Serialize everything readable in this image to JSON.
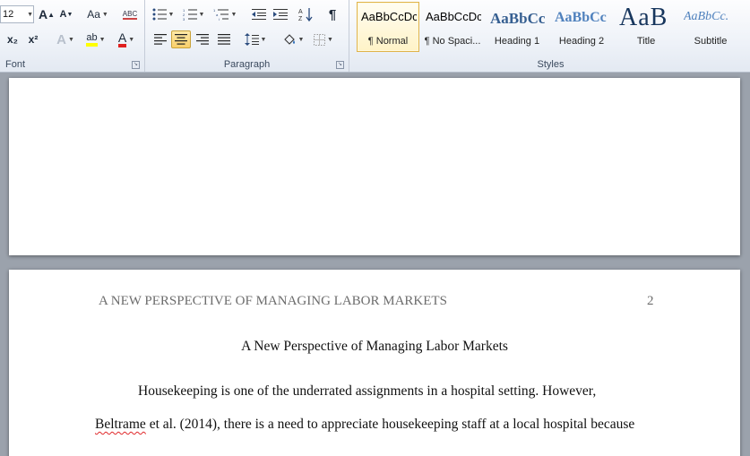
{
  "ribbon": {
    "font_group": {
      "label": "Font",
      "font_size": "12",
      "grow_font": "A",
      "shrink_font": "A",
      "change_case": "Aa",
      "clear_format": "ABC",
      "subscript": "x₂",
      "superscript": "x²",
      "text_effects": "A",
      "highlight": "ab",
      "font_color": "A",
      "highlight_color": "#ffff00",
      "font_color_value": "#e02020"
    },
    "paragraph_group": {
      "label": "Paragraph",
      "pilcrow": "¶"
    },
    "styles_group": {
      "label": "Styles",
      "tiles": [
        {
          "sample": "AaBbCcDc",
          "name": "¶ Normal",
          "color": "#000000"
        },
        {
          "sample": "AaBbCcDc",
          "name": "¶ No Spaci...",
          "color": "#000000"
        },
        {
          "sample": "AaBbCc",
          "name": "Heading 1",
          "color": "#365f91"
        },
        {
          "sample": "AaBbCc",
          "name": "Heading 2",
          "color": "#4f81bd"
        },
        {
          "sample": "AaB",
          "name": "Title",
          "color": "#17365d"
        },
        {
          "sample": "AaBbCc.",
          "name": "Subtitle",
          "color": "#4f81bd"
        }
      ]
    }
  },
  "document": {
    "running_head": "A NEW PERSPECTIVE OF MANAGING LABOR MARKETS",
    "page_number": "2",
    "title": "A New Perspective of Managing Labor Markets",
    "line1": "Housekeeping is one of the underrated assignments in a hospital setting. However,",
    "line2_misspelled": "Beltrame",
    "line2_rest": " et al. (2014), there is a need to appreciate housekeeping staff at a local hospital because"
  }
}
